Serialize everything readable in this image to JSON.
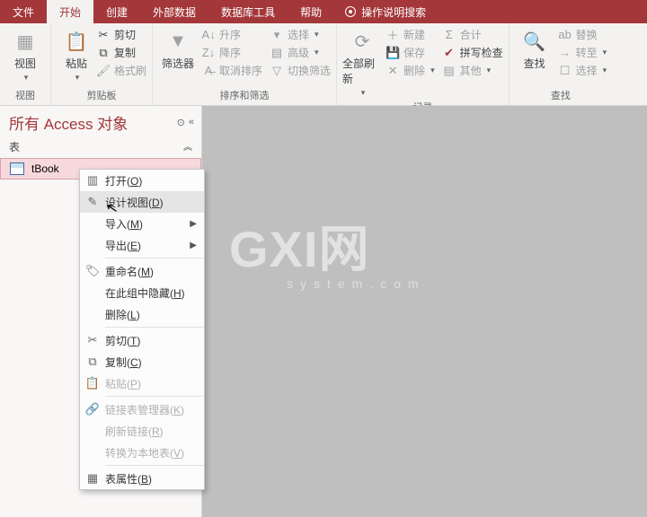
{
  "menubar": {
    "tabs": [
      "文件",
      "开始",
      "创建",
      "外部数据",
      "数据库工具",
      "帮助"
    ],
    "active_index": 1,
    "tell_me": "操作说明搜索"
  },
  "ribbon": {
    "groups": {
      "view": {
        "label": "视图",
        "btn": "视图"
      },
      "clip": {
        "label": "剪贴板",
        "paste": "粘贴",
        "cut": "剪切",
        "copy": "复制",
        "fmt": "格式刷"
      },
      "sort": {
        "label": "排序和筛选",
        "filter": "筛选器",
        "asc": "升序",
        "desc": "降序",
        "clear": "取消排序",
        "sel": "选择",
        "adv": "高级",
        "toggle": "切换筛选"
      },
      "records": {
        "label": "记录",
        "refresh": "全部刷新",
        "new": "新建",
        "save": "保存",
        "delete": "删除",
        "totals": "合计",
        "spell": "拼写检查",
        "more": "其他"
      },
      "find": {
        "label": "查找",
        "find": "查找",
        "replace": "替换",
        "goto": "转至",
        "select": "选择"
      }
    }
  },
  "nav": {
    "title": "所有 Access 对象",
    "section": "表",
    "items": [
      "tBook"
    ]
  },
  "context_menu": {
    "items": [
      {
        "icon": "open",
        "label": "打开(O)"
      },
      {
        "icon": "design",
        "label": "设计视图(D)",
        "hover": true
      },
      {
        "label": "导入(M)",
        "sub": true
      },
      {
        "label": "导出(E)",
        "sub": true
      },
      {
        "sep": true
      },
      {
        "icon": "rename",
        "label": "重命名(M)"
      },
      {
        "label": "在此组中隐藏(H)"
      },
      {
        "label": "删除(L)"
      },
      {
        "sep": true
      },
      {
        "icon": "cut",
        "label": "剪切(T)"
      },
      {
        "icon": "copy",
        "label": "复制(C)"
      },
      {
        "icon": "paste",
        "label": "粘贴(P)",
        "disabled": true
      },
      {
        "sep": true
      },
      {
        "icon": "link",
        "label": "链接表管理器(K)",
        "disabled": true
      },
      {
        "label": "刷新链接(R)",
        "disabled": true
      },
      {
        "label": "转换为本地表(V)",
        "disabled": true
      },
      {
        "sep": true
      },
      {
        "icon": "props",
        "label": "表属性(B)"
      }
    ]
  },
  "watermark": {
    "big": "GXI网",
    "small": "system.com"
  }
}
